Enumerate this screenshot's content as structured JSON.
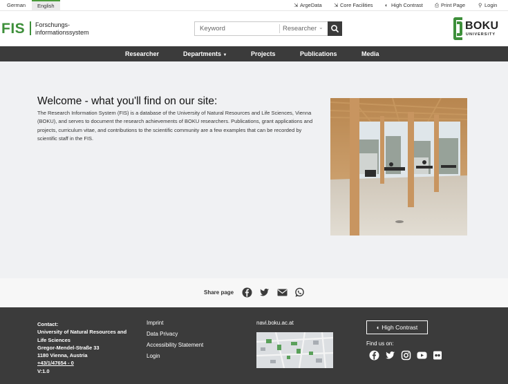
{
  "topbar": {
    "languages": [
      "German",
      "English"
    ],
    "links": [
      "ArgeData",
      "Core Facilities",
      "High Contrast",
      "Print Page",
      "Login"
    ]
  },
  "header": {
    "logo": "FIS",
    "subtitle_line1": "Forschungs-",
    "subtitle_line2": "informationssystem",
    "search_placeholder": "Keyword",
    "search_scope": "Researcher",
    "university_name": "BOKU",
    "university_sub": "UNIVERSITY",
    "brand_color": "#3d8f3a"
  },
  "nav": {
    "items": [
      "Researcher",
      "Departments",
      "Projects",
      "Publications",
      "Media"
    ]
  },
  "main": {
    "title": "Welcome - what you'll find on our site:",
    "text": "The Research Information System (FIS) is a database of the University of Natural Resources and Life Sciences, Vienna (BOKU), and serves to document the research achievements of BOKU researchers. Publications, grant applications and projects, curriculum vitae, and contributions to the scientific community are a few examples that can be recorded by scientific staff in the FIS."
  },
  "share": {
    "label": "Share page",
    "icons": [
      "facebook-icon",
      "twitter-icon",
      "mail-icon",
      "whatsapp-icon"
    ]
  },
  "footer": {
    "contact_label": "Contact:",
    "contact_org1": "University of Natural Resources and",
    "contact_org2": "Life Sciences",
    "contact_street": "Gregor-Mendel-Straße 33",
    "contact_city": "1180 Vienna, Austria",
    "contact_phone": "+43/1/47654 - 0",
    "version": "V:1.0",
    "links": [
      "Imprint",
      "Data Privacy",
      "Accessibility Statement",
      "Login"
    ],
    "navi_label": "navi.boku.ac.at",
    "high_contrast": "High Contrast",
    "find_us": "Find us on:",
    "social_icons": [
      "facebook-icon",
      "twitter-icon",
      "instagram-icon",
      "youtube-icon",
      "flickr-icon"
    ]
  }
}
